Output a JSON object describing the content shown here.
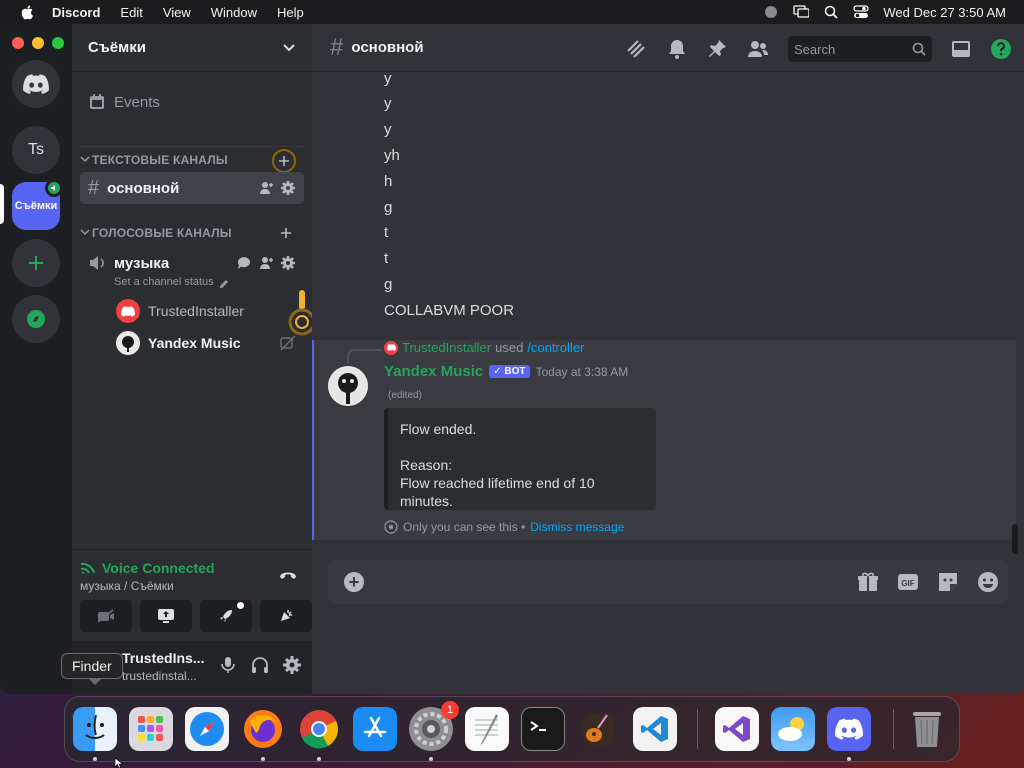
{
  "menubar": {
    "app": "Discord",
    "items": [
      "Edit",
      "View",
      "Window",
      "Help"
    ],
    "clock": "Wed Dec 27  3:50 AM"
  },
  "guilds": {
    "ts_label": "Ts",
    "active_label": "Съёмки"
  },
  "server": {
    "name": "Съёмки",
    "events_label": "Events",
    "text_category": "ТЕКСТОВЫЕ КАНАЛЫ",
    "text_channel": "основной",
    "voice_category": "ГОЛОСОВЫЕ КАНАЛЫ",
    "voice_channel": "музыка",
    "channel_status": "Set a channel status",
    "voice_users": [
      "TrustedInstaller",
      "Yandex Music"
    ]
  },
  "voice": {
    "title": "Voice Connected",
    "subtitle": "музыка / Съёмки"
  },
  "user": {
    "name": "TrustedIns...",
    "sub": "trustedinstal..."
  },
  "channel": {
    "title": "основной",
    "search_placeholder": "Search"
  },
  "messages": {
    "lines": [
      "y",
      "y",
      "y",
      "yh",
      "h",
      "g",
      "t",
      "t",
      "g",
      "COLLABVM POOR"
    ],
    "reply_user": "TrustedInstaller",
    "reply_used": "used",
    "reply_command": "/controller",
    "bot_name": "Yandex Music",
    "bot_tag": "BOT",
    "timestamp": "Today at 3:38 AM",
    "edited": "(edited)",
    "embed_line1": "Flow ended.",
    "embed_line2": "Reason:",
    "embed_line3": "Flow reached lifetime end of 10 minutes.",
    "ephemeral": "Only you can see this •",
    "dismiss": "Dismiss message"
  },
  "dock": {
    "tooltip": "Finder",
    "settings_badge": "1",
    "apps": [
      "Finder",
      "Launchpad",
      "Safari",
      "Firefox",
      "Chrome",
      "App Store",
      "System Settings",
      "TextEdit",
      "Terminal",
      "GarageBand",
      "VS Code",
      "Visual Studio",
      "Weather",
      "Discord",
      "Trash"
    ]
  },
  "colors": {
    "blurple": "#5865f2",
    "green": "#23a55a",
    "link": "#00a8fc",
    "bg": "#313338"
  }
}
